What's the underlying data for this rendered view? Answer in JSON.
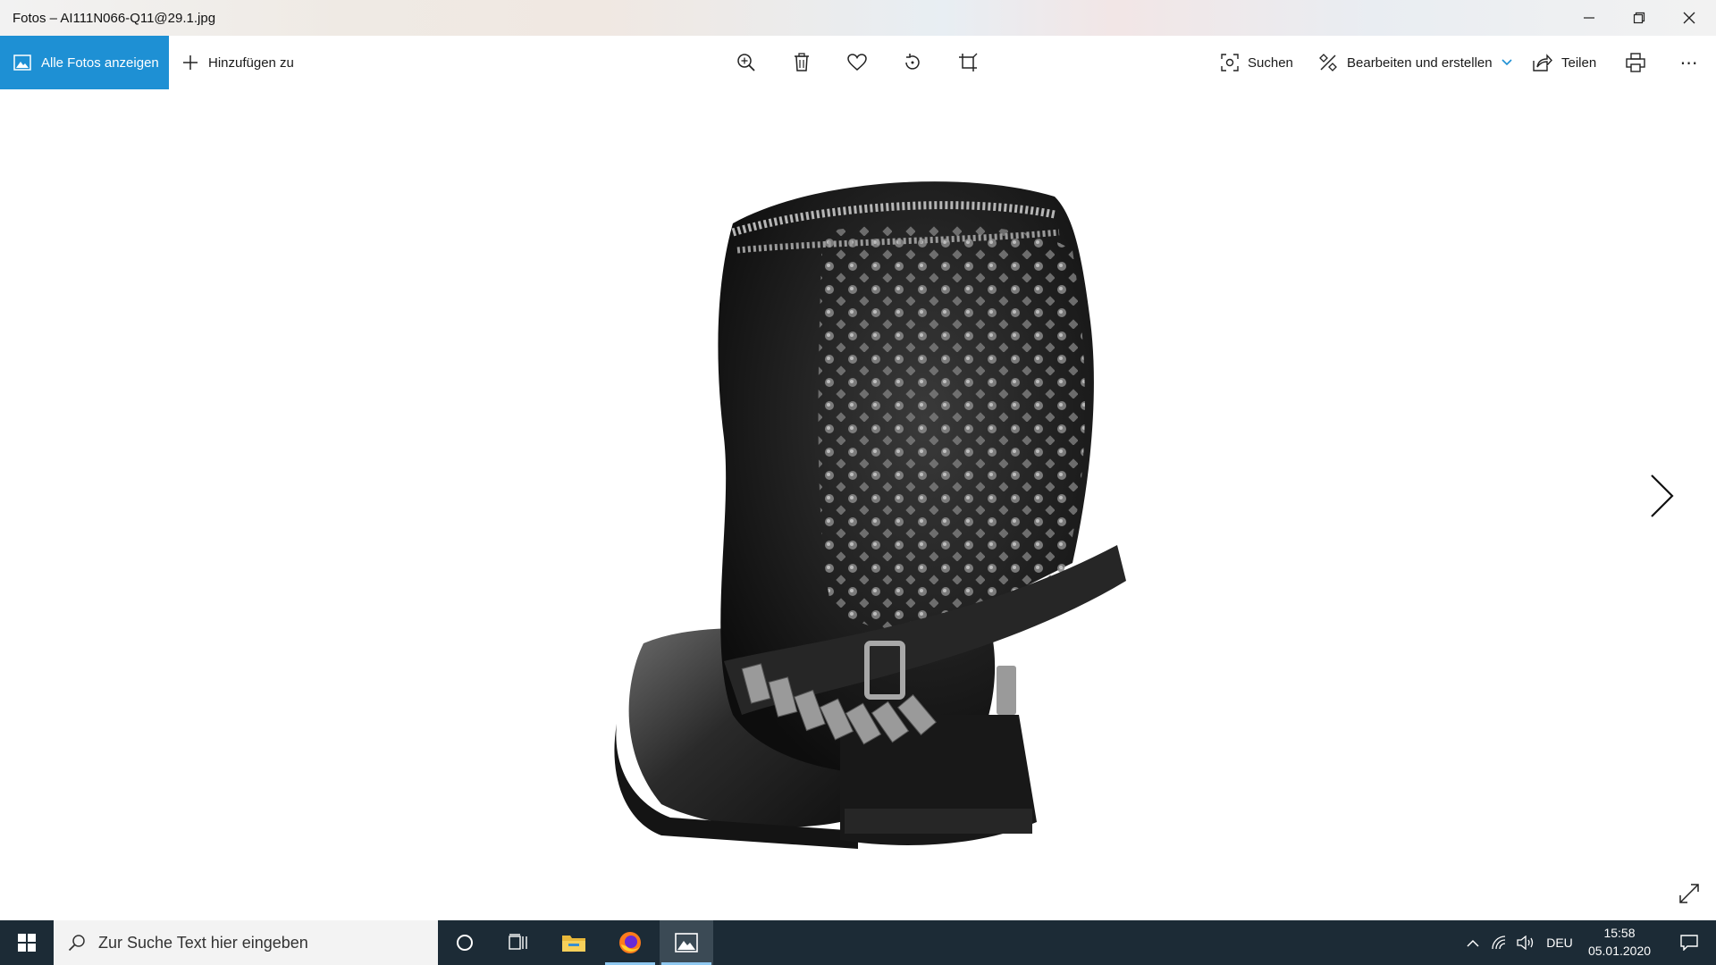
{
  "window": {
    "title": "Fotos – AI111N066-Q11@29.1.jpg"
  },
  "commandbar": {
    "all_photos_label": "Alle Fotos anzeigen",
    "add_to_label": "Hinzufügen zu",
    "search_label": "Suchen",
    "edit_create_label": "Bearbeiten und erstellen",
    "share_label": "Teilen",
    "more_label": "⋯"
  },
  "icons": {
    "zoom": "zoom-in-icon",
    "delete": "trash-icon",
    "favorite": "heart-icon",
    "rotate": "rotate-icon",
    "crop": "crop-icon",
    "print": "printer-icon"
  },
  "taskbar": {
    "search_placeholder": "Zur Suche Text hier eingeben",
    "language": "DEU",
    "time": "15:58",
    "date": "05.01.2020"
  },
  "colors": {
    "accent": "#1e90d4",
    "taskbar": "#1c2b36"
  }
}
